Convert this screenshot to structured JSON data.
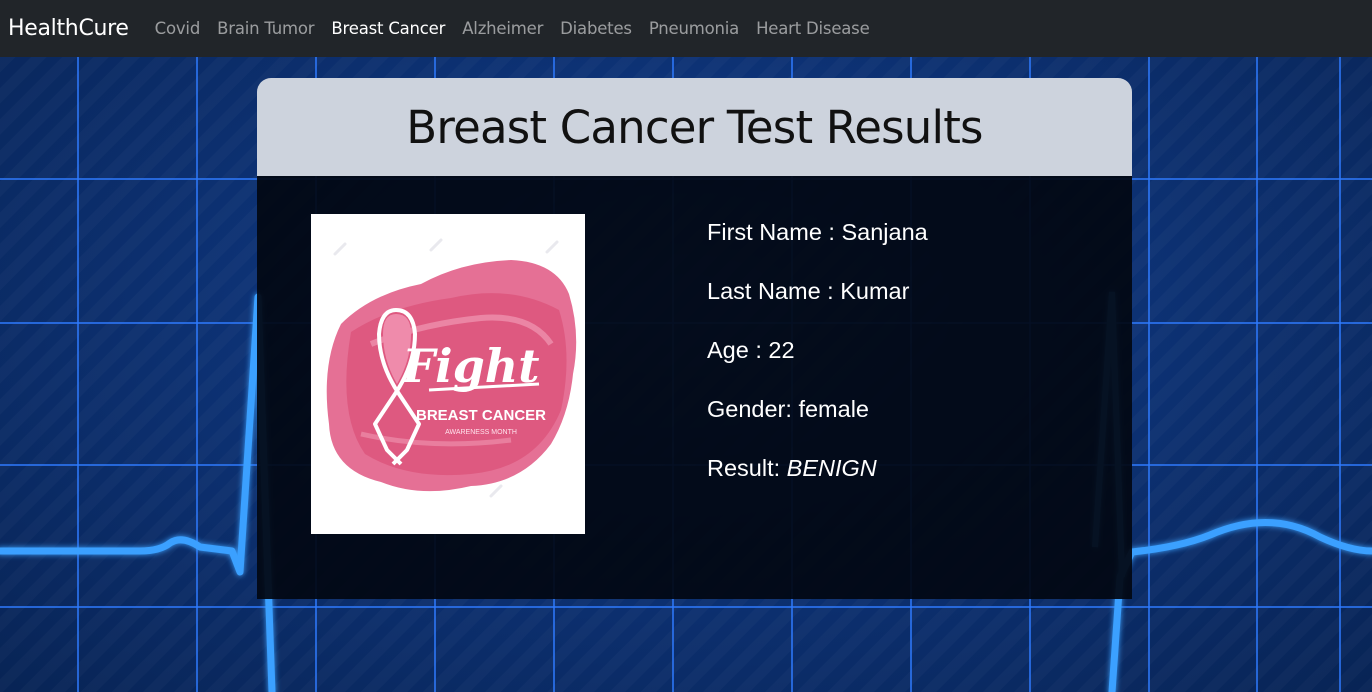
{
  "navbar": {
    "brand": "HealthCure",
    "links": [
      {
        "label": "Covid",
        "active": false
      },
      {
        "label": "Brain Tumor",
        "active": false
      },
      {
        "label": "Breast Cancer",
        "active": true
      },
      {
        "label": "Alzheimer",
        "active": false
      },
      {
        "label": "Diabetes",
        "active": false
      },
      {
        "label": "Pneumonia",
        "active": false
      },
      {
        "label": "Heart Disease",
        "active": false
      }
    ]
  },
  "card": {
    "title": "Breast Cancer Test Results",
    "image": {
      "fight_text": "Fight",
      "line1": "BREAST CANCER",
      "line2": "AWARENESS MONTH"
    },
    "fields": [
      {
        "label": "First Name : ",
        "value": "Sanjana"
      },
      {
        "label": "Last Name : ",
        "value": "Kumar"
      },
      {
        "label": "Age : ",
        "value": "22"
      },
      {
        "label": "Gender: ",
        "value": "female"
      },
      {
        "label": "Result: ",
        "value": "BENIGN"
      }
    ]
  },
  "colors": {
    "navbar": "#212529",
    "header": "#cdd3dd",
    "grid": "#2f7bff",
    "pulse": "#3aa0ff",
    "ribbon": "#e0527e"
  }
}
